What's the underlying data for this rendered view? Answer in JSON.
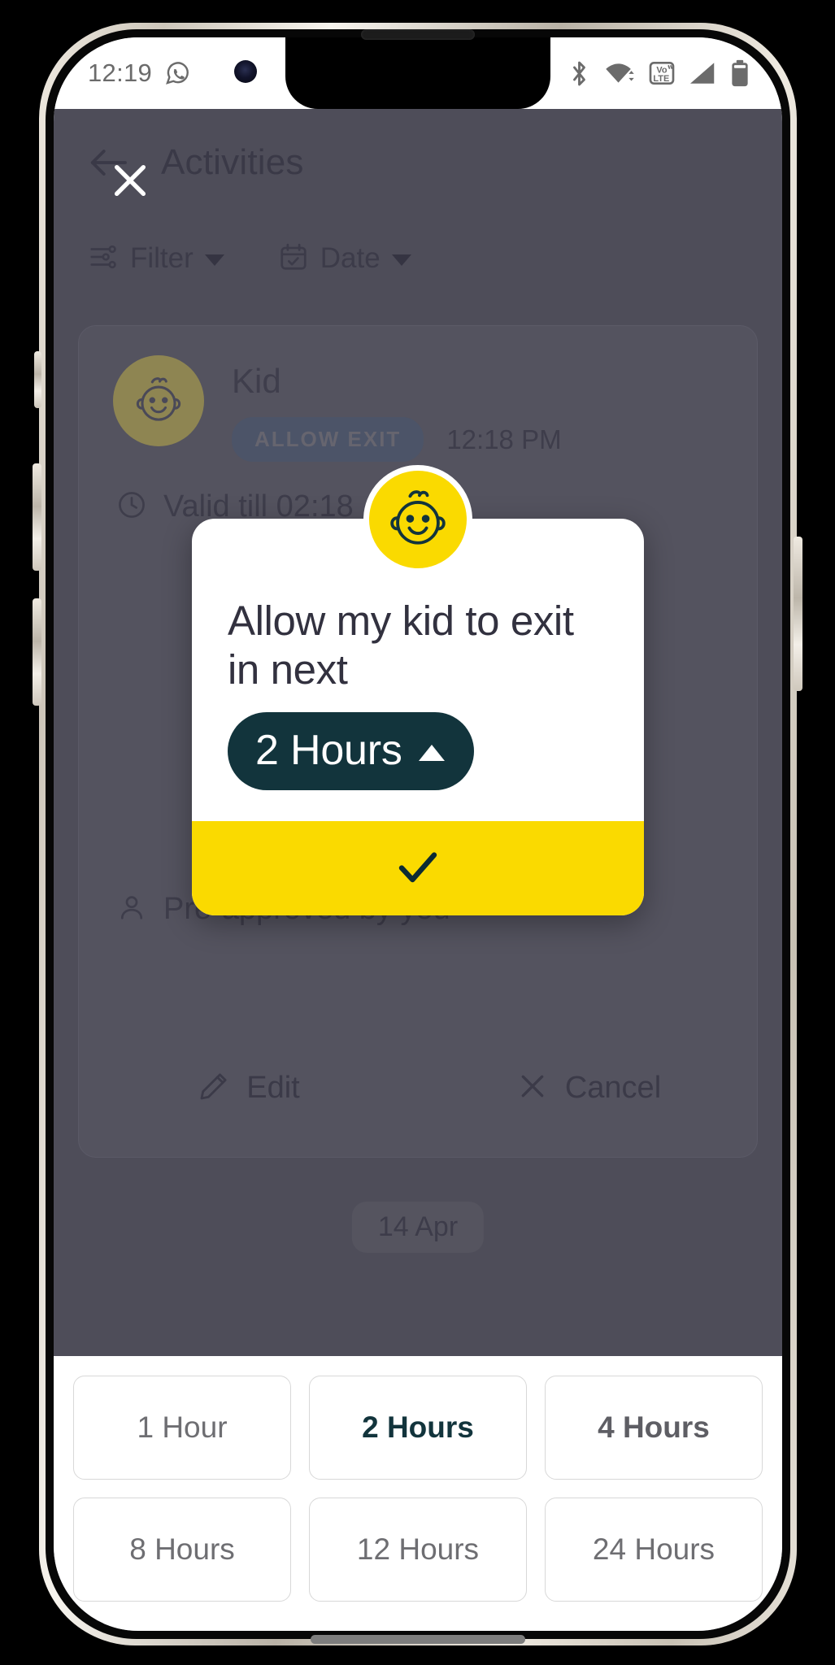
{
  "status_bar": {
    "time": "12:19",
    "left_icons": [
      "whatsapp-icon"
    ],
    "right_icons": [
      "bluetooth-icon",
      "wifi-icon",
      "volte-icon",
      "signal-icon",
      "battery-icon"
    ]
  },
  "app": {
    "title": "Activities",
    "back_icon": "back-arrow-icon",
    "close_icon": "close-icon",
    "filters": [
      {
        "label": "Filter",
        "icon": "sliders-icon"
      },
      {
        "label": "Date",
        "icon": "calendar-check-icon"
      }
    ],
    "activity": {
      "name": "Kid",
      "avatar_icon": "kid-face-icon",
      "badge": "ALLOW EXIT",
      "time": "12:18 PM",
      "valid_till": "Valid till 02:18",
      "pre_approved": "Pre-approved by you",
      "valid_icon": "clock-icon",
      "person_icon": "person-icon",
      "actions": [
        {
          "label": "Edit",
          "icon": "pencil-icon"
        },
        {
          "label": "Cancel",
          "icon": "close-icon"
        }
      ]
    },
    "date_chip": "14 Apr"
  },
  "dialog": {
    "avatar_icon": "kid-face-icon",
    "title": "Allow my kid to exit in next",
    "duration_value": "2 Hours",
    "duration_caret_icon": "chevron-up-icon",
    "confirm_icon": "check-icon"
  },
  "sheet": {
    "options": [
      {
        "label": "1 Hour",
        "state": "normal"
      },
      {
        "label": "2 Hours",
        "state": "selected"
      },
      {
        "label": "4 Hours",
        "state": "semi"
      },
      {
        "label": "8 Hours",
        "state": "normal"
      },
      {
        "label": "12 Hours",
        "state": "normal"
      },
      {
        "label": "24 Hours",
        "state": "normal"
      }
    ]
  },
  "colors": {
    "brand_yellow": "#fada00",
    "brand_dark": "#12343c",
    "scrim": "#4e4d59",
    "status_icon_gray": "#6b6b6b"
  }
}
